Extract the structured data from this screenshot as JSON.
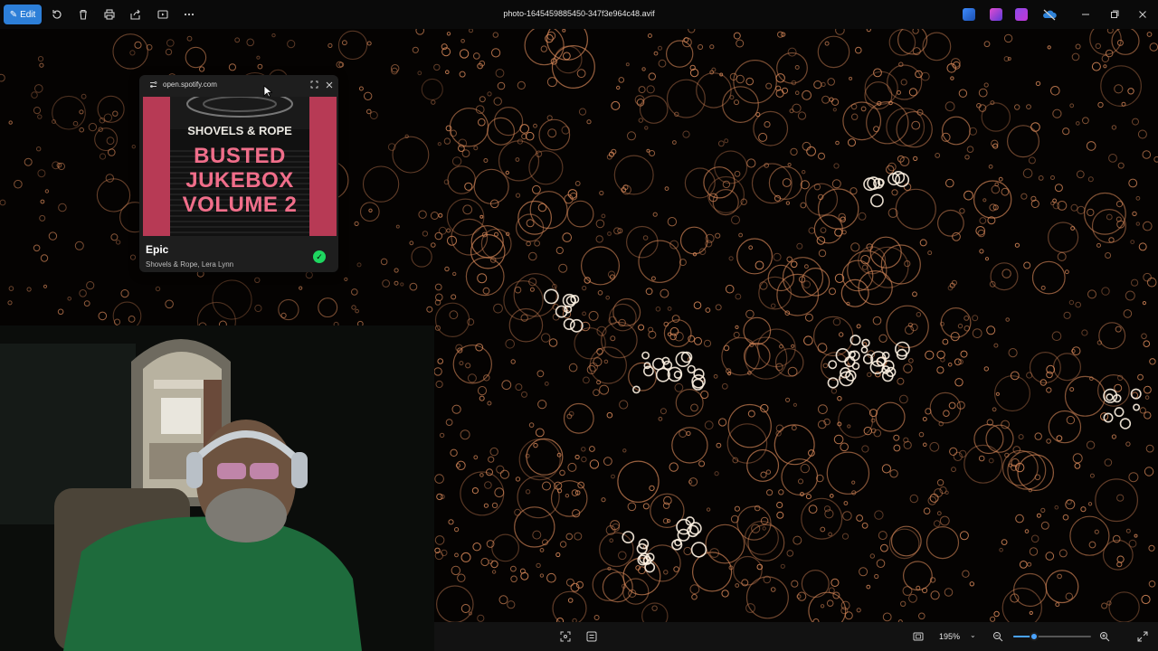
{
  "toolbar": {
    "edit_label": "Edit",
    "icons": [
      "rotate-icon",
      "delete-icon",
      "print-icon",
      "share-icon",
      "slideshow-icon",
      "more-icon"
    ]
  },
  "window": {
    "title": "photo-1645459885450-347f3e964c48.avif"
  },
  "spotify_popup": {
    "url": "open.spotify.com",
    "cover_artist": "SHOVELS & ROPE",
    "cover_title_line1": "BUSTED",
    "cover_title_line2": "JUKEBOX",
    "cover_title_line3": "VOLUME 2",
    "song_title": "Epic",
    "song_artists": "Shovels & Rope, Lera Lynn",
    "saved_check": "✓"
  },
  "statusbar": {
    "zoom_label": "195%",
    "zoom_chevron": "⌄",
    "zoom_level": 0.27
  },
  "colors": {
    "accent": "#2d7fd8",
    "slider": "#4aa3ff",
    "spotify_green": "#1ed760",
    "cover_bg": "#b73a55",
    "cover_title": "#f06e8a",
    "bokeh": "#d9895a"
  }
}
